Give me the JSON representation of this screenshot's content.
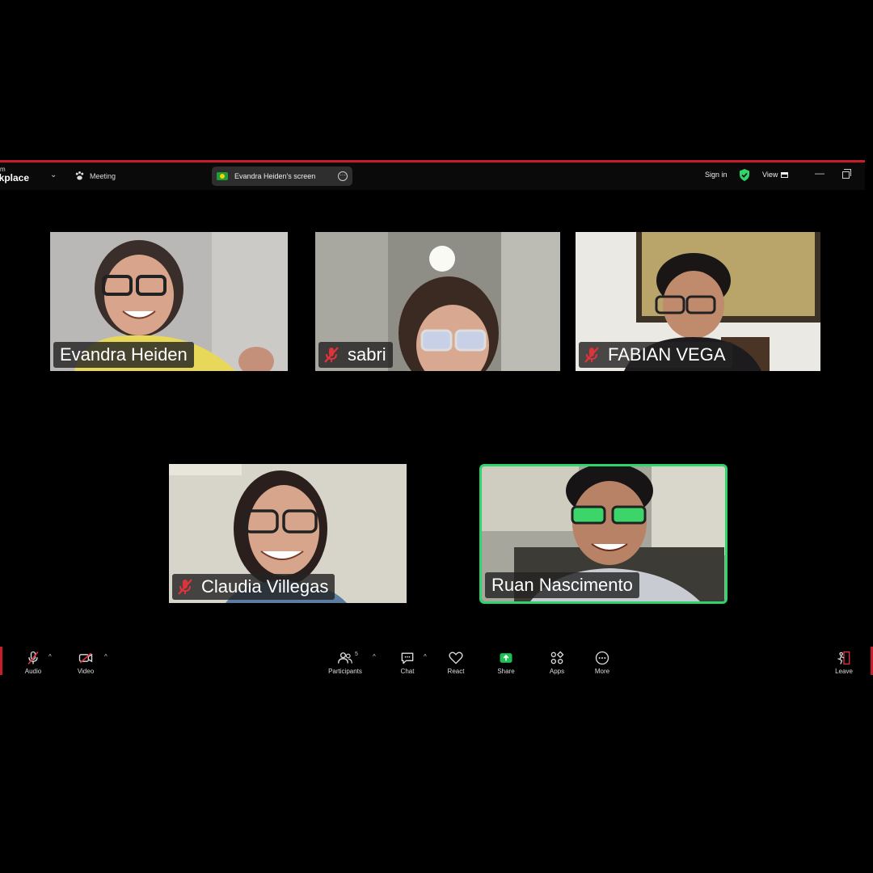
{
  "window": {
    "app_line1": "m",
    "app_line2": "rkplace",
    "meeting_label": "Meeting",
    "share_label": "Evandra Heiden's screen",
    "sign_in": "Sign in",
    "view_label": "View"
  },
  "participants": [
    {
      "name": "Evandra Heiden",
      "muted": false
    },
    {
      "name": "sabri",
      "muted": true
    },
    {
      "name": "FABIAN VEGA",
      "muted": true
    },
    {
      "name": "Claudia Villegas",
      "muted": true
    },
    {
      "name": "Ruan Nascimento",
      "muted": false,
      "active_speaker": true
    }
  ],
  "toolbar": {
    "audio": "Audio",
    "video": "Video",
    "participants": "Participants",
    "participants_count": "5",
    "chat": "Chat",
    "react": "React",
    "share": "Share",
    "apps": "Apps",
    "more": "More",
    "leave": "Leave"
  },
  "colors": {
    "frame": "#c81e2a",
    "active_speaker": "#2fd46a",
    "share_button": "#1fbf55",
    "muted_icon": "#e0323a"
  }
}
